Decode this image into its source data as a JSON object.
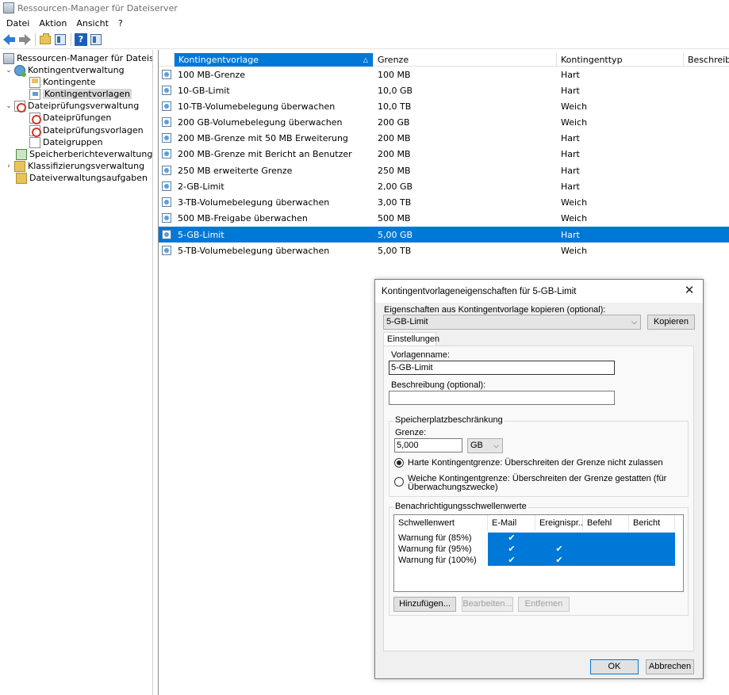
{
  "window": {
    "title": "Ressourcen-Manager für Dateiserver"
  },
  "menu": {
    "items": [
      "Datei",
      "Aktion",
      "Ansicht",
      "?"
    ]
  },
  "toolbar": {
    "icons": [
      "back-icon",
      "forward-icon",
      "up-folder-icon",
      "show-tree-icon",
      "help-icon",
      "show-action-pane-icon"
    ]
  },
  "tree": {
    "items": [
      {
        "label": "Ressourcen-Manager für Dateiserver (l",
        "icon": "server-icon",
        "expander": ""
      },
      {
        "label": "Kontingentverwaltung",
        "icon": "quota-icon",
        "expander": "⌄"
      },
      {
        "label": "Kontingente",
        "icon": "quota-folder-icon",
        "expander": ""
      },
      {
        "label": "Kontingentvorlagen",
        "icon": "template-icon",
        "expander": ""
      },
      {
        "label": "Dateiprüfungsverwaltung",
        "icon": "screening-icon",
        "expander": "⌄"
      },
      {
        "label": "Dateiprüfungen",
        "icon": "file-screen-icon",
        "expander": ""
      },
      {
        "label": "Dateiprüfungsvorlagen",
        "icon": "screen-template-icon",
        "expander": ""
      },
      {
        "label": "Dateigruppen",
        "icon": "file-group-icon",
        "expander": ""
      },
      {
        "label": "Speicherberichteverwaltung",
        "icon": "report-icon",
        "expander": ""
      },
      {
        "label": "Klassifizierungsverwaltung",
        "icon": "classification-icon",
        "expander": "›"
      },
      {
        "label": "Dateiverwaltungsaufgaben",
        "icon": "task-folder-icon",
        "expander": ""
      }
    ]
  },
  "list": {
    "columns": [
      "Kontingentvorlage",
      "Grenze",
      "Kontingenttyp",
      "Beschreibun"
    ],
    "sort_indicator": "△",
    "rows": [
      {
        "name": "100 MB-Grenze",
        "limit": "100 MB",
        "type": "Hart"
      },
      {
        "name": "10-GB-Limit",
        "limit": "10,0 GB",
        "type": "Hart"
      },
      {
        "name": "10-TB-Volumebelegung überwachen",
        "limit": "10,0 TB",
        "type": "Weich"
      },
      {
        "name": "200 GB-Volumebelegung überwachen",
        "limit": "200 GB",
        "type": "Weich"
      },
      {
        "name": "200 MB-Grenze mit 50 MB Erweiterung",
        "limit": "200 MB",
        "type": "Hart"
      },
      {
        "name": "200 MB-Grenze mit Bericht an Benutzer",
        "limit": "200 MB",
        "type": "Hart"
      },
      {
        "name": "250 MB erweiterte Grenze",
        "limit": "250 MB",
        "type": "Hart"
      },
      {
        "name": "2-GB-Limit",
        "limit": "2,00 GB",
        "type": "Hart"
      },
      {
        "name": "3-TB-Volumebelegung überwachen",
        "limit": "3,00 TB",
        "type": "Weich"
      },
      {
        "name": "500 MB-Freigabe überwachen",
        "limit": "500 MB",
        "type": "Weich"
      },
      {
        "name": "5-GB-Limit",
        "limit": "5,00 GB",
        "type": "Hart"
      },
      {
        "name": "5-TB-Volumebelegung überwachen",
        "limit": "5,00 TB",
        "type": "Weich"
      }
    ],
    "selected_row": "5-GB-Limit"
  },
  "dialog": {
    "title": "Kontingentvorlageneigenschaften für 5-GB-Limit",
    "close": "✕",
    "copy_label": "Eigenschaften aus Kontingentvorlage kopieren (optional):",
    "copy_value": "5-GB-Limit",
    "copy_button": "Kopieren",
    "tab": "Einstellungen",
    "name_label": "Vorlagenname:",
    "name_value": "5-GB-Limit",
    "description_label": "Beschreibung (optional):",
    "description_value": "",
    "space_group": "Speicherplatzbeschränkung",
    "limit_label": "Grenze:",
    "limit_value": "5,000",
    "unit_value": "GB",
    "hard_quota": "Harte Kontingentgrenze: Überschreiten der Grenze nicht zulassen",
    "soft_quota_line1": "Weiche Kontingentgrenze: Überschreiten der Grenze gestatten (für",
    "soft_quota_line2": "Überwachungszwecke)",
    "threshold_group": "Benachrichtigungsschwellenwerte",
    "threshold_columns": [
      "Schwellenwert",
      "E-Mail",
      "Ereignispr...",
      "Befehl",
      "Bericht"
    ],
    "thresholds": [
      {
        "name": "Warnung für (85%)",
        "email": "✔",
        "event": "",
        "command": "",
        "report": ""
      },
      {
        "name": "Warnung für (95%)",
        "email": "✔",
        "event": "✔",
        "command": "",
        "report": ""
      },
      {
        "name": "Warnung für (100%)",
        "email": "✔",
        "event": "✔",
        "command": "",
        "report": ""
      }
    ],
    "add_button": "Hinzufügen...",
    "edit_button": "Bearbeiten...",
    "remove_button": "Entfernen",
    "ok_button": "OK",
    "cancel_button": "Abbrechen"
  },
  "colors": {
    "selection": "#0078d7",
    "dialog_bg": "#f0f0f0"
  }
}
